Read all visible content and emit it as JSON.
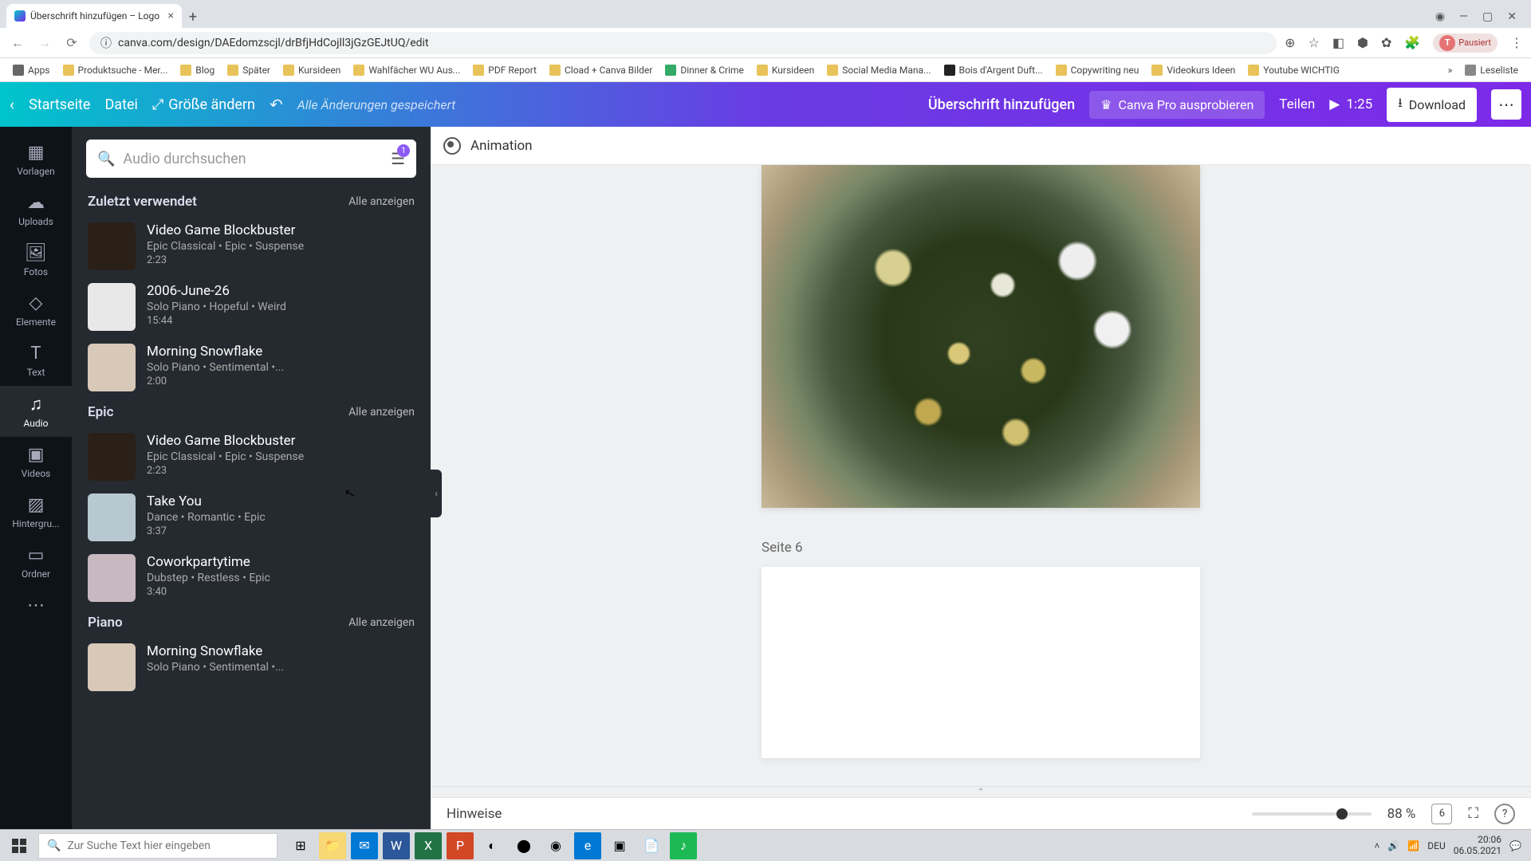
{
  "browser": {
    "tab_title": "Überschrift hinzufügen – Logo",
    "url": "canva.com/design/DAEdomzscjl/drBfjHdCojll3jGzGEJtUQ/edit",
    "bookmarks": [
      "Apps",
      "Produktsuche - Mer...",
      "Blog",
      "Später",
      "Kursideen",
      "Wahlfächer WU Aus...",
      "PDF Report",
      "Cload + Canva Bilder",
      "Dinner & Crime",
      "Kursideen",
      "Social Media Mana...",
      "Bois d'Argent Duft...",
      "Copywriting neu",
      "Videokurs Ideen",
      "Youtube WICHTIG",
      "Leseliste"
    ],
    "ext_label": "Pausiert"
  },
  "header": {
    "home": "Startseite",
    "file": "Datei",
    "resize": "Größe ändern",
    "saved": "Alle Änderungen gespeichert",
    "doc_title": "Überschrift hinzufügen",
    "pro": "Canva Pro ausprobieren",
    "share": "Teilen",
    "duration": "1:25",
    "download": "Download"
  },
  "rail": {
    "items": [
      "Vorlagen",
      "Uploads",
      "Fotos",
      "Elemente",
      "Text",
      "Audio",
      "Videos",
      "Hintergru...",
      "Ordner"
    ],
    "active_index": 5
  },
  "search": {
    "placeholder": "Audio durchsuchen",
    "badge": "1"
  },
  "sections": [
    {
      "title": "Zuletzt verwendet",
      "all": "Alle anzeigen",
      "tracks": [
        {
          "title": "Video Game Blockbuster",
          "tags": "Epic Classical • Epic • Suspense",
          "dur": "2:23",
          "bg": "#2a2018"
        },
        {
          "title": "2006-June-26",
          "tags": "Solo Piano • Hopeful • Weird",
          "dur": "15:44",
          "bg": "#e8e8e8"
        },
        {
          "title": "Morning Snowflake",
          "tags": "Solo Piano • Sentimental •...",
          "dur": "2:00",
          "bg": "#d8c8b8"
        }
      ]
    },
    {
      "title": "Epic",
      "all": "Alle anzeigen",
      "tracks": [
        {
          "title": "Video Game Blockbuster",
          "tags": "Epic Classical • Epic • Suspense",
          "dur": "2:23",
          "bg": "#2a2018"
        },
        {
          "title": "Take You",
          "tags": "Dance • Romantic • Epic",
          "dur": "3:37",
          "bg": "#b8c8d0"
        },
        {
          "title": "Coworkpartytime",
          "tags": "Dubstep • Restless • Epic",
          "dur": "3:40",
          "bg": "#c8b8c0"
        }
      ]
    },
    {
      "title": "Piano",
      "all": "Alle anzeigen",
      "tracks": [
        {
          "title": "Morning Snowflake",
          "tags": "Solo Piano • Sentimental •...",
          "dur": "",
          "bg": "#d8c8b8"
        }
      ]
    }
  ],
  "context": {
    "animation": "Animation"
  },
  "canvas": {
    "page_label": "Seite 6"
  },
  "footer": {
    "notes": "Hinweise",
    "zoom": "88 %",
    "page_ind": "6"
  },
  "taskbar": {
    "search_placeholder": "Zur Suche Text hier eingeben",
    "lang": "DEU",
    "time": "20:06",
    "date": "06.05.2021"
  }
}
